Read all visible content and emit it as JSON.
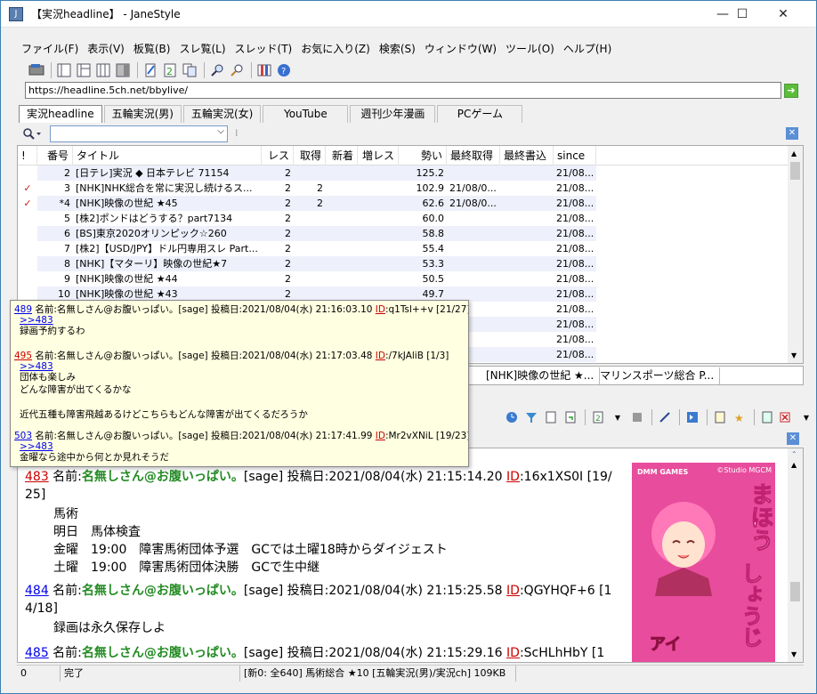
{
  "window": {
    "title": "【実況headline】 - JaneStyle",
    "min": "—",
    "max": "☐",
    "close": "✕"
  },
  "menu": [
    "ファイル(F)",
    "表示(V)",
    "板覧(B)",
    "スレ覧(L)",
    "スレッド(T)",
    "お気に入り(Z)",
    "検索(S)",
    "ウィンドウ(W)",
    "ツール(O)",
    "ヘルプ(H)"
  ],
  "address": {
    "url": "https://headline.5ch.net/bbylive/"
  },
  "board_tabs": [
    "実況headline",
    "五輪実況(男)",
    "五輪実況(女)",
    "YouTube",
    "週刊少年漫画",
    "PCゲーム"
  ],
  "thread_list": {
    "columns": [
      "!",
      "番号",
      "タイトル",
      "レス",
      "取得",
      "新着",
      "増レス",
      "勢い",
      "最終取得",
      "最終書込",
      "since"
    ],
    "rows": [
      {
        "mark": "",
        "num": "2",
        "title": "[日テレ]実況 ◆ 日本テレビ 71154",
        "res": "2",
        "got": "",
        "new": "",
        "inc": "",
        "speed": "125.2",
        "last_get": "",
        "last_post": "",
        "since": "21/08..."
      },
      {
        "mark": "✓",
        "num": "3",
        "title": "[NHK]NHK総合を常に実況し続けるス...",
        "res": "2",
        "got": "2",
        "new": "",
        "inc": "",
        "speed": "102.9",
        "last_get": "21/08/0...",
        "last_post": "",
        "since": "21/08..."
      },
      {
        "mark": "✓",
        "num": "*4",
        "title": "[NHK]映像の世紀 ★45",
        "res": "2",
        "got": "2",
        "new": "",
        "inc": "",
        "speed": "62.6",
        "last_get": "21/08/0...",
        "last_post": "",
        "since": "21/08..."
      },
      {
        "mark": "",
        "num": "5",
        "title": "[株2]ポンドはどうする？part7134",
        "res": "2",
        "got": "",
        "new": "",
        "inc": "",
        "speed": "60.0",
        "last_get": "",
        "last_post": "",
        "since": "21/08..."
      },
      {
        "mark": "",
        "num": "6",
        "title": "[BS]東京2020オリンピック☆260",
        "res": "2",
        "got": "",
        "new": "",
        "inc": "",
        "speed": "58.8",
        "last_get": "",
        "last_post": "",
        "since": "21/08..."
      },
      {
        "mark": "",
        "num": "7",
        "title": "[株2]【USD/JPY】ドル円専用スレ Part...",
        "res": "2",
        "got": "",
        "new": "",
        "inc": "",
        "speed": "55.4",
        "last_get": "",
        "last_post": "",
        "since": "21/08..."
      },
      {
        "mark": "",
        "num": "8",
        "title": "[NHK]【マターリ】映像の世紀★7",
        "res": "2",
        "got": "",
        "new": "",
        "inc": "",
        "speed": "53.3",
        "last_get": "",
        "last_post": "",
        "since": "21/08..."
      },
      {
        "mark": "",
        "num": "9",
        "title": "[NHK]映像の世紀 ★44",
        "res": "2",
        "got": "",
        "new": "",
        "inc": "",
        "speed": "50.5",
        "last_get": "",
        "last_post": "",
        "since": "21/08..."
      },
      {
        "mark": "",
        "num": "10",
        "title": "[NHK]映像の世紀 ★43",
        "res": "2",
        "got": "",
        "new": "",
        "inc": "",
        "speed": "49.7",
        "last_get": "",
        "last_post": "",
        "since": "21/08..."
      },
      {
        "mark": "",
        "num": "",
        "title": "",
        "res": "",
        "got": "",
        "new": "",
        "inc": "",
        "speed": "",
        "last_get": "",
        "last_post": "",
        "since": "21/08..."
      },
      {
        "mark": "",
        "num": "",
        "title": "",
        "res": "",
        "got": "",
        "new": "",
        "inc": "",
        "speed": "",
        "last_get": "",
        "last_post": "",
        "since": "21/08..."
      },
      {
        "mark": "",
        "num": "",
        "title": "",
        "res": "",
        "got": "",
        "new": "",
        "inc": "",
        "speed": "",
        "last_get": "",
        "last_post": "",
        "since": "21/08..."
      },
      {
        "mark": "",
        "num": "",
        "title": "",
        "res": "",
        "got": "",
        "new": "",
        "inc": "",
        "speed": "",
        "last_get": "",
        "last_post": "",
        "since": "21/08..."
      }
    ]
  },
  "popup": {
    "posts": [
      {
        "num": "489",
        "head": " 名前:名無しさん@お腹いっぱい。[sage] 投稿日:2021/08/04(水) 21:16:03.10 ",
        "id_label": "ID",
        "id": ":q1Tsl++v [21/27]",
        "anchor": ">>483",
        "lines": [
          "録画予約するわ"
        ]
      },
      {
        "num": "495",
        "head": " 名前:名無しさん@お腹いっぱい。[sage] 投稿日:2021/08/04(水) 21:17:03.48 ",
        "id_label": "ID",
        "id": ":/7kJAliB [1/3]",
        "anchor": ">>483",
        "lines": [
          "団体も楽しみ",
          "どんな障害が出てくるかな",
          "",
          "近代五種も障害飛越あるけどこちらもどんな障害が出てくるだろうか"
        ]
      },
      {
        "num": "503",
        "head": " 名前:名無しさん@お腹いっぱい。[sage] 投稿日:2021/08/04(水) 21:17:41.99 ",
        "id_label": "ID",
        "id": ":Mr2vXNiL [19/23]",
        "anchor": ">>483",
        "lines": [
          "金曜なら途中から何とか見れそうだ"
        ]
      }
    ]
  },
  "thread_tabs": [
    "[NHK]映像の世紀 ★...",
    "マリンスポーツ総合 P..."
  ],
  "thread": {
    "posts": [
      {
        "num": "483",
        "name_label": " 名前:",
        "name": "名無しさん@お腹いっぱい。",
        "rest": "[sage] 投稿日:2021/08/04(水) 21:15:14.20 ",
        "id_label": "ID",
        "id": ":16x1XS0I [19/",
        "id_cont": "25]",
        "lines": [
          "馬術",
          "明日　馬体検査",
          "金曜　19:00　障害馬術団体予選　GCでは土曜18時からダイジェスト",
          "土曜　19:00　障害馬術団体決勝　GCで生中継"
        ]
      },
      {
        "num": "484",
        "name_label": " 名前:",
        "name": "名無しさん@お腹いっぱい。",
        "rest": "[sage] 投稿日:2021/08/04(水) 21:15:25.58 ",
        "id_label": "ID",
        "id": ":QGYHQF+6 [1",
        "id_cont": "4/18]",
        "lines": [
          "録画は永久保存しよ"
        ]
      },
      {
        "num": "485",
        "name_label": " 名前:",
        "name": "名無しさん@お腹いっぱい。",
        "rest": "[sage] 投稿日:2021/08/04(水) 21:15:29.16 ",
        "id_label": "ID",
        "id": ":ScHLhHbY [1",
        "id_cont": "",
        "lines": []
      }
    ]
  },
  "ad": {
    "brand": "DMM GAMES",
    "credit": "©Studio MGCM",
    "title_1": "まほう",
    "title_2": "しょうじ",
    "sub": "アイ"
  },
  "status": {
    "count": "0",
    "state": "完了",
    "info": "[新0: 全640] 馬術総合 ★10 [五輪実況(男)/実況ch] 109KB"
  }
}
